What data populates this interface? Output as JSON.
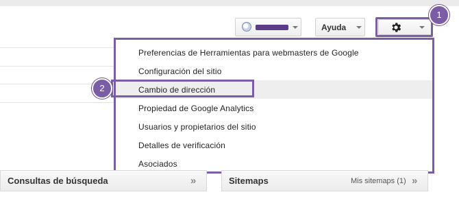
{
  "header": {
    "account_switcher": {
      "globe_icon": "globe-icon",
      "redaction_color": "#5a3d86"
    },
    "help_label": "Ayuda",
    "settings": {
      "icon": "gear-icon"
    }
  },
  "settings_menu": {
    "items": [
      {
        "label": "Preferencias de Herramientas para webmasters de Google"
      },
      {
        "label": "Configuración del sitio"
      },
      {
        "label": "Cambio de dirección"
      },
      {
        "label": "Propiedad de Google Analytics"
      },
      {
        "label": "Usuarios y propietarios del sitio"
      },
      {
        "label": "Detalles de verificación"
      },
      {
        "label": "Asociados"
      }
    ],
    "active_index": 2
  },
  "annotations": {
    "step1": "1",
    "step2": "2",
    "highlight_color": "#7b5da6"
  },
  "panels": {
    "search_queries": {
      "title": "Consultas de búsqueda",
      "chevron": "»"
    },
    "sitemaps": {
      "title": "Sitemaps",
      "link": "Mis sitemaps (1)",
      "chevron": "»"
    }
  }
}
